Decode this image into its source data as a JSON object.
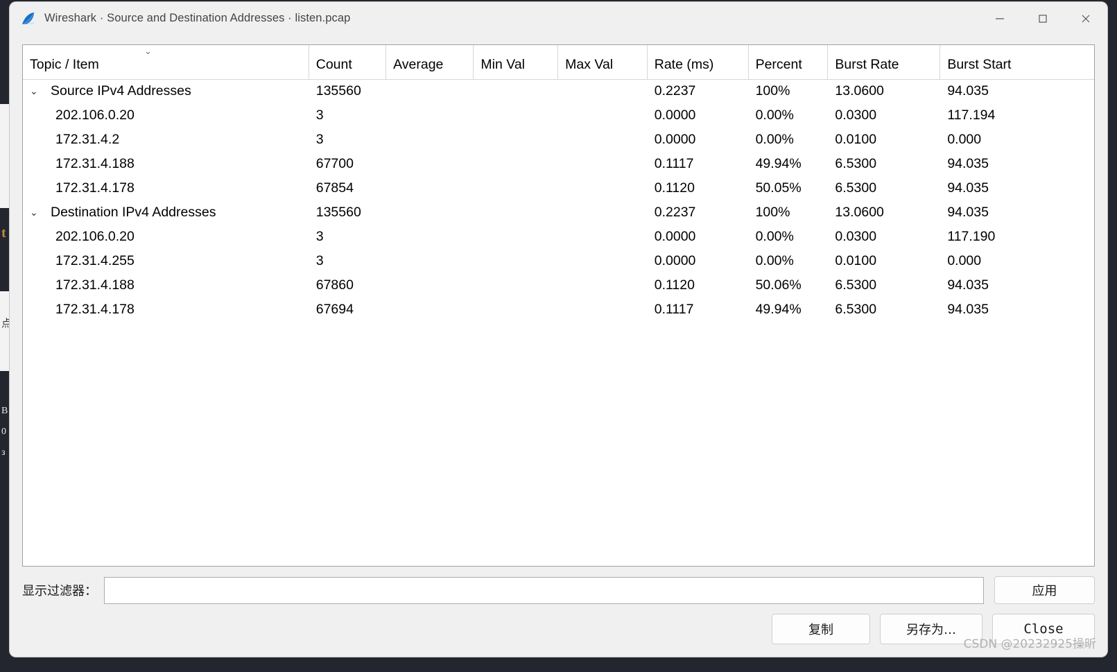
{
  "window": {
    "title": "Wireshark · Source and Destination Addresses · listen.pcap",
    "icon": "wireshark-fin-icon",
    "minimize_label": "—",
    "maximize_label": "☐",
    "close_label": "✕"
  },
  "table": {
    "sort_indicator": "⌄",
    "columns": [
      "Topic / Item",
      "Count",
      "Average",
      "Min Val",
      "Max Val",
      "Rate (ms)",
      "Percent",
      "Burst Rate",
      "Burst Start"
    ],
    "rows": [
      {
        "type": "group",
        "toggle": "⌄",
        "label": "Source IPv4 Addresses",
        "count": "135560",
        "average": "",
        "min_val": "",
        "max_val": "",
        "rate_ms": "0.2237",
        "percent": "100%",
        "burst_rate": "13.0600",
        "burst_start": "94.035"
      },
      {
        "type": "child",
        "toggle": "",
        "label": "202.106.0.20",
        "count": "3",
        "average": "",
        "min_val": "",
        "max_val": "",
        "rate_ms": "0.0000",
        "percent": "0.00%",
        "burst_rate": "0.0300",
        "burst_start": "117.194"
      },
      {
        "type": "child",
        "toggle": "",
        "label": "172.31.4.2",
        "count": "3",
        "average": "",
        "min_val": "",
        "max_val": "",
        "rate_ms": "0.0000",
        "percent": "0.00%",
        "burst_rate": "0.0100",
        "burst_start": "0.000"
      },
      {
        "type": "child",
        "toggle": "",
        "label": "172.31.4.188",
        "count": "67700",
        "average": "",
        "min_val": "",
        "max_val": "",
        "rate_ms": "0.1117",
        "percent": "49.94%",
        "burst_rate": "6.5300",
        "burst_start": "94.035"
      },
      {
        "type": "child",
        "toggle": "",
        "label": "172.31.4.178",
        "count": "67854",
        "average": "",
        "min_val": "",
        "max_val": "",
        "rate_ms": "0.1120",
        "percent": "50.05%",
        "burst_rate": "6.5300",
        "burst_start": "94.035"
      },
      {
        "type": "group",
        "toggle": "⌄",
        "label": "Destination IPv4 Addresses",
        "count": "135560",
        "average": "",
        "min_val": "",
        "max_val": "",
        "rate_ms": "0.2237",
        "percent": "100%",
        "burst_rate": "13.0600",
        "burst_start": "94.035"
      },
      {
        "type": "child",
        "toggle": "",
        "label": "202.106.0.20",
        "count": "3",
        "average": "",
        "min_val": "",
        "max_val": "",
        "rate_ms": "0.0000",
        "percent": "0.00%",
        "burst_rate": "0.0300",
        "burst_start": "117.190"
      },
      {
        "type": "child",
        "toggle": "",
        "label": "172.31.4.255",
        "count": "3",
        "average": "",
        "min_val": "",
        "max_val": "",
        "rate_ms": "0.0000",
        "percent": "0.00%",
        "burst_rate": "0.0100",
        "burst_start": "0.000"
      },
      {
        "type": "child",
        "toggle": "",
        "label": "172.31.4.188",
        "count": "67860",
        "average": "",
        "min_val": "",
        "max_val": "",
        "rate_ms": "0.1120",
        "percent": "50.06%",
        "burst_rate": "6.5300",
        "burst_start": "94.035"
      },
      {
        "type": "child",
        "toggle": "",
        "label": "172.31.4.178",
        "count": "67694",
        "average": "",
        "min_val": "",
        "max_val": "",
        "rate_ms": "0.1117",
        "percent": "49.94%",
        "burst_rate": "6.5300",
        "burst_start": "94.035"
      }
    ]
  },
  "filter": {
    "label": "显示过滤器：",
    "value": "",
    "placeholder": "",
    "apply_label": "应用"
  },
  "buttons": {
    "copy_label": "复制",
    "save_as_label": "另存为…",
    "close_label": "Close"
  },
  "watermark": "CSDN @20232925操昕",
  "colors": {
    "dialog_bg": "#f0f0f0",
    "table_bg": "#ffffff",
    "accent": "#1a6fc4",
    "text": "#000000"
  }
}
